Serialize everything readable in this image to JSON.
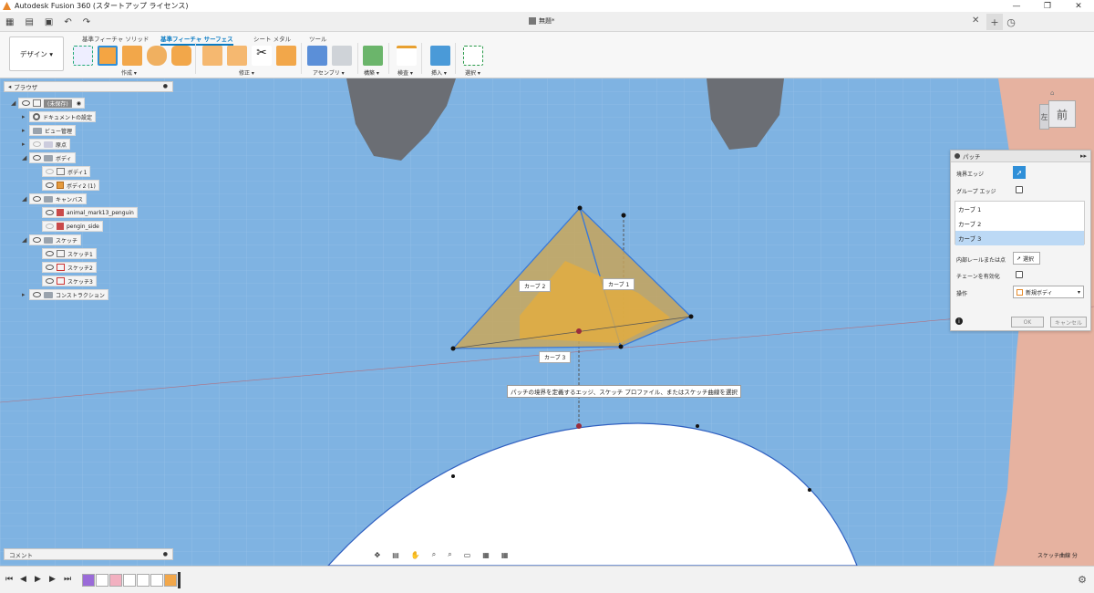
{
  "window": {
    "title": "Autodesk Fusion 360 (スタートアップ ライセンス)",
    "controls": [
      "—",
      "❐",
      "✕"
    ]
  },
  "doc_tab": {
    "name": "無題*"
  },
  "ribbon": {
    "workspace": "デザイン ▾",
    "tabs": [
      "基準フィーチャ ソリッド",
      "基準フィーチャ サーフェス",
      "シート メタル",
      "ツール"
    ],
    "active_tab": 1,
    "groups": [
      "作成 ▾",
      "修正 ▾",
      "アセンブリ ▾",
      "構築 ▾",
      "検査 ▾",
      "挿入 ▾",
      "選択 ▾"
    ]
  },
  "browser": {
    "title": "ブラウザ",
    "items": [
      {
        "label": "(未保存)",
        "level": 0
      },
      {
        "label": "ドキュメントの設定",
        "level": 1
      },
      {
        "label": "ビュー管理",
        "level": 1
      },
      {
        "label": "原点",
        "level": 1
      },
      {
        "label": "ボディ",
        "level": 1
      },
      {
        "label": "ボディ1",
        "level": 2
      },
      {
        "label": "ボディ2 (1)",
        "level": 2
      },
      {
        "label": "キャンバス",
        "level": 1
      },
      {
        "label": "animal_mark13_penguin",
        "level": 2
      },
      {
        "label": "pengin_side",
        "level": 2
      },
      {
        "label": "スケッチ",
        "level": 1
      },
      {
        "label": "スケッチ1",
        "level": 2
      },
      {
        "label": "スケッチ2",
        "level": 2
      },
      {
        "label": "スケッチ3",
        "level": 2
      },
      {
        "label": "コンストラクション",
        "level": 1
      }
    ]
  },
  "comment": {
    "label": "コメント"
  },
  "viewcube": {
    "front": "前",
    "left": "左"
  },
  "patch_dialog": {
    "title": "パッチ",
    "boundary_edge_label": "境界エッジ",
    "group_edge_label": "グループ エッジ",
    "curves": [
      "カーブ 1",
      "カーブ 2",
      "カーブ 3"
    ],
    "selected_curve": 2,
    "interior_label": "内部レールまたは点",
    "interior_btn": "選択",
    "chain_label": "チェーンを有効化",
    "operation_label": "操作",
    "operation_value": "新規ボディ",
    "ok": "OK",
    "cancel": "キャンセル"
  },
  "canvas": {
    "curve_labels": [
      "カーブ 2",
      "カーブ 1",
      "カーブ 3"
    ],
    "tooltip": "パッチの境界を定義するエッジ、スケッチ プロファイル、またはスケッチ曲線を選択",
    "status": "スケッチ曲線 分"
  },
  "colors": {
    "accent": "#0b7cc4",
    "sky": "#7fb3e2",
    "patch_fill": "#c9a75a",
    "selected_row": "#bcd9f5"
  }
}
